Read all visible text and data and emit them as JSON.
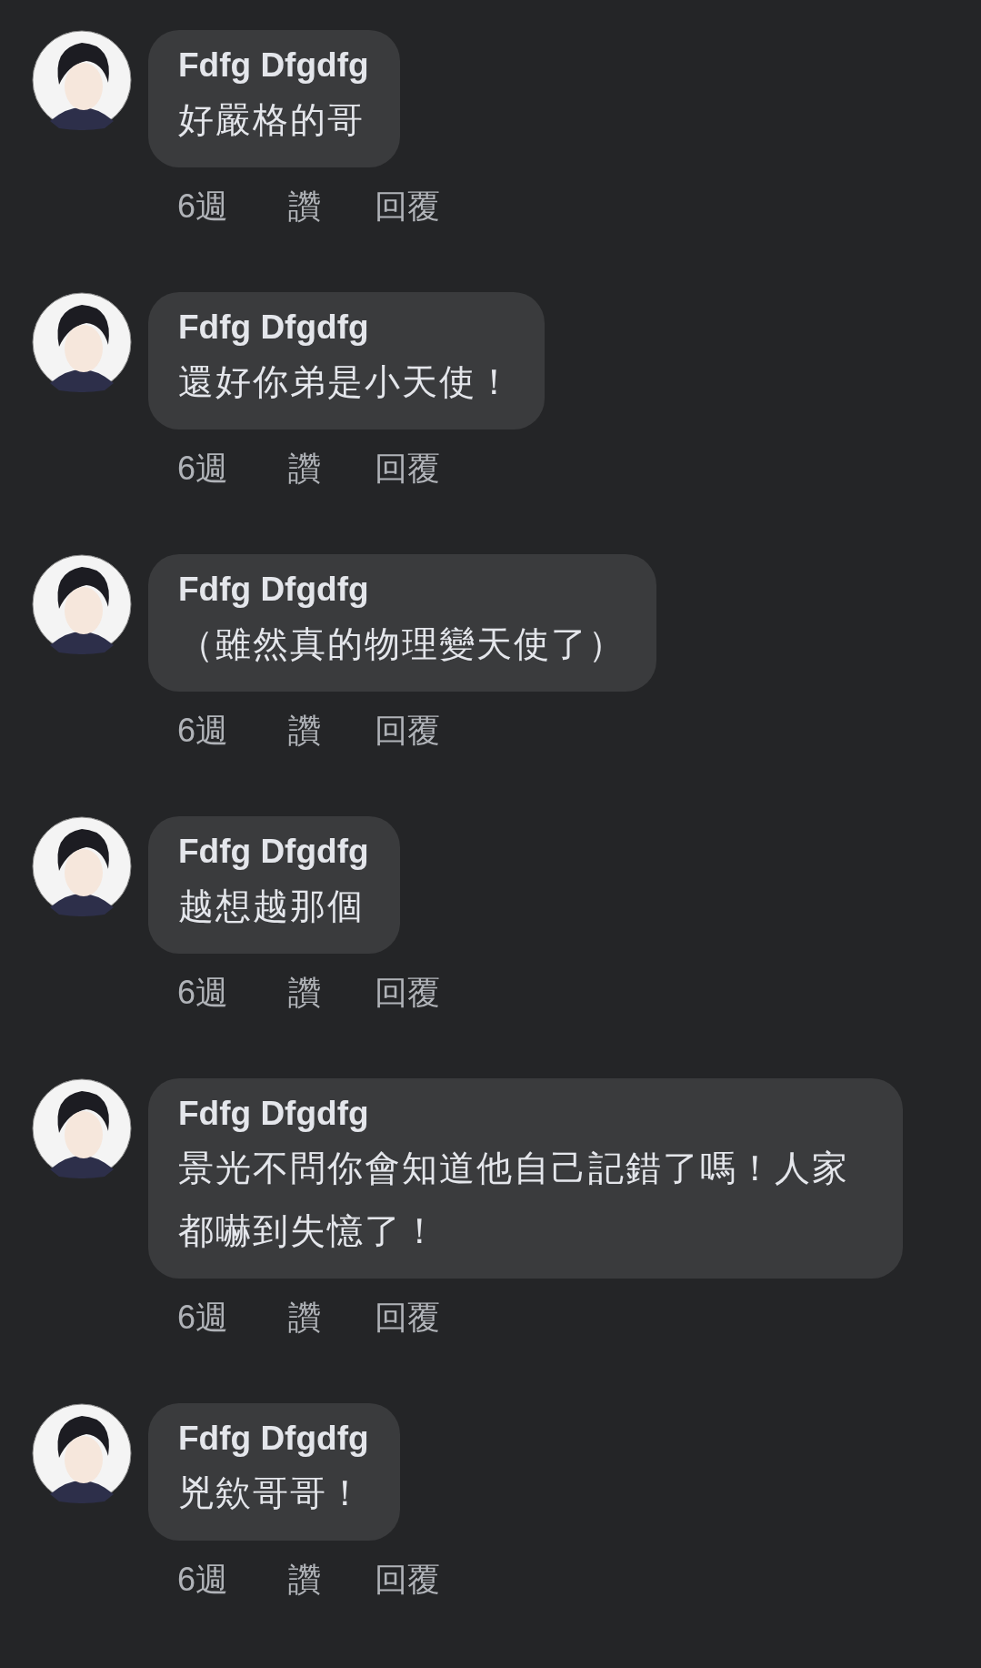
{
  "comments": [
    {
      "author": "Fdfg Dfgdfg",
      "text": "好嚴格的哥",
      "time": "6週",
      "like": "讚",
      "reply": "回覆"
    },
    {
      "author": "Fdfg Dfgdfg",
      "text": "還好你弟是小天使！",
      "time": "6週",
      "like": "讚",
      "reply": "回覆"
    },
    {
      "author": "Fdfg Dfgdfg",
      "text": "（雖然真的物理變天使了）",
      "time": "6週",
      "like": "讚",
      "reply": "回覆"
    },
    {
      "author": "Fdfg Dfgdfg",
      "text": "越想越那個",
      "time": "6週",
      "like": "讚",
      "reply": "回覆"
    },
    {
      "author": "Fdfg Dfgdfg",
      "text": "景光不問你會知道他自己記錯了嗎！人家都嚇到失憶了！",
      "time": "6週",
      "like": "讚",
      "reply": "回覆"
    },
    {
      "author": "Fdfg Dfgdfg",
      "text": "兇欸哥哥！",
      "time": "6週",
      "like": "讚",
      "reply": "回覆"
    }
  ]
}
